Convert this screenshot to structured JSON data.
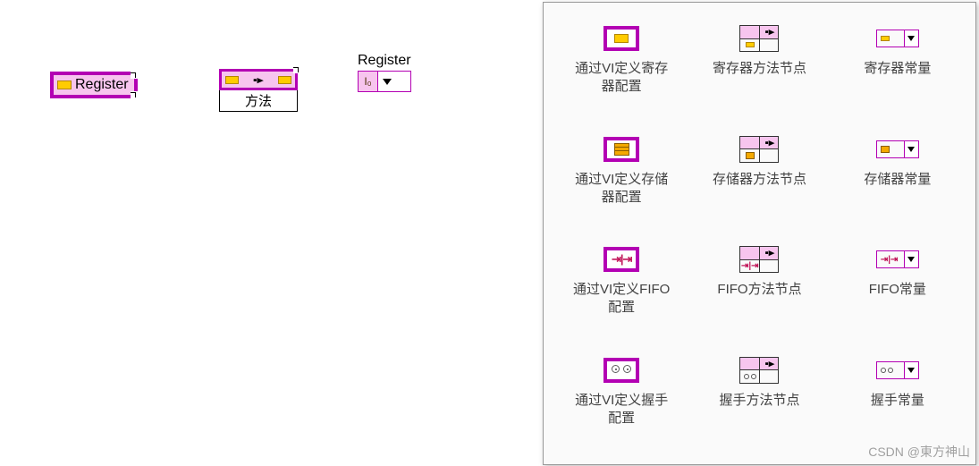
{
  "diagram": {
    "register_node_label": "Register",
    "method_node_label": "方法",
    "constant_label": "Register",
    "constant_value_glyph": "I₀"
  },
  "palette": {
    "rows": [
      {
        "col1": "通过VI定义寄存\n器配置",
        "col2": "寄存器方法节点",
        "col3": "寄存器常量"
      },
      {
        "col1": "通过VI定义存储\n器配置",
        "col2": "存储器方法节点",
        "col3": "存储器常量"
      },
      {
        "col1": "通过VI定义FIFO\n配置",
        "col2": "FIFO方法节点",
        "col3": "FIFO常量"
      },
      {
        "col1": "通过VI定义握手\n配置",
        "col2": "握手方法节点",
        "col3": "握手常量"
      }
    ]
  },
  "watermark": "CSDN @東方神山"
}
